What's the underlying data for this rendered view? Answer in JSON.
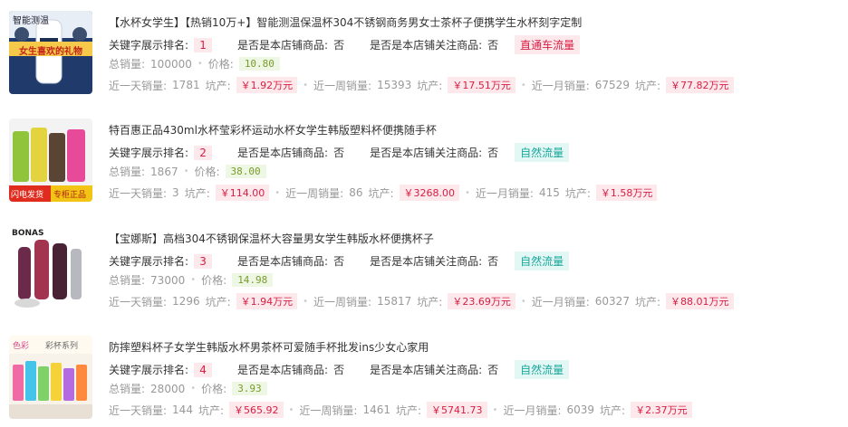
{
  "labels": {
    "rank": "关键字展示排名:",
    "own_store": "是否是本店铺商品:",
    "followed_store": "是否是本店铺关注商品:",
    "total_sales": "总销量:",
    "price": "价格:",
    "day_sales": "近一天销量:",
    "week_sales": "近一周销量:",
    "month_sales": "近一月销量:",
    "pit_output": "坑产:"
  },
  "items": [
    {
      "title": "【水杯女学生】【热销10万+】智能测温保温杯304不锈钢商务男女士茶杯子便携学生水杯刻字定制",
      "rank": "1",
      "own_store": "否",
      "followed_store": "否",
      "traffic": "直通车流量",
      "total_sales": "100000",
      "price": "10.80",
      "day_sales": "1781",
      "day_output": "￥1.92万元",
      "week_sales": "15393",
      "week_output": "￥17.51万元",
      "month_sales": "67529",
      "month_output": "￥77.82万元",
      "thumb_text": [
        "智能测温",
        "女生喜欢的礼物"
      ]
    },
    {
      "title": "特百惠正品430ml水杯莹彩杯运动水杯女学生韩版塑料杯便携随手杯",
      "rank": "2",
      "own_store": "否",
      "followed_store": "否",
      "traffic": "自然流量",
      "total_sales": "1867",
      "price": "38.00",
      "day_sales": "3",
      "day_output": "￥114.00",
      "week_sales": "86",
      "week_output": "￥3268.00",
      "month_sales": "415",
      "month_output": "￥1.58万元",
      "thumb_text": [
        "闪电发货",
        "专柜正品"
      ]
    },
    {
      "title": "【宝娜斯】高档304不锈钢保温杯大容量男女学生韩版水杯便携杯子",
      "rank": "3",
      "own_store": "否",
      "followed_store": "否",
      "traffic": "自然流量",
      "total_sales": "73000",
      "price": "14.98",
      "day_sales": "1296",
      "day_output": "￥1.94万元",
      "week_sales": "15817",
      "week_output": "￥23.69万元",
      "month_sales": "60327",
      "month_output": "￥88.01万元",
      "thumb_text": [
        "BONAS"
      ]
    },
    {
      "title": "防摔塑料杯子女学生韩版水杯男茶杯可爱随手杯批发ins少女心家用",
      "rank": "4",
      "own_store": "否",
      "followed_store": "否",
      "traffic": "自然流量",
      "total_sales": "28000",
      "price": "3.93",
      "day_sales": "144",
      "day_output": "￥565.92",
      "week_sales": "1461",
      "week_output": "￥5741.73",
      "month_sales": "6039",
      "month_output": "￥2.37万元",
      "thumb_text": [
        "色彩",
        "彩杯系列"
      ]
    }
  ],
  "colors": {
    "red": "#d81e42",
    "red_bg": "#fde8ec",
    "green_bg": "#eef7e4",
    "green": "#7c9b2e",
    "teal": "#1aa79a",
    "teal_bg": "#e3f7f5"
  }
}
